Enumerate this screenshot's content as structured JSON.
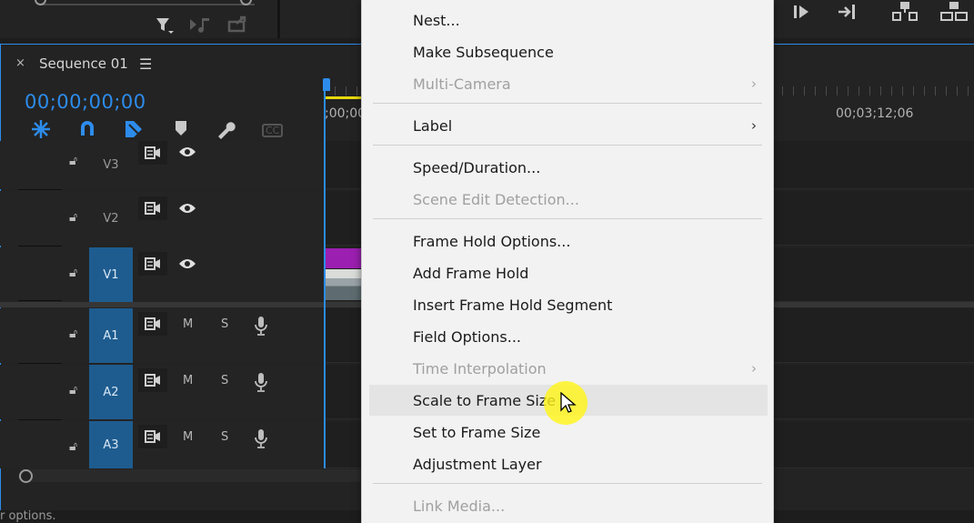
{
  "sequence": {
    "title": "Sequence 01",
    "close_glyph": "×",
    "menu_glyph": "☰",
    "timecode": "00;00;00;00"
  },
  "ruler": {
    "start_label": ";00;00",
    "right_label": "00;03;12;06"
  },
  "tracks": [
    {
      "label": "V3",
      "type": "video",
      "targeted": false
    },
    {
      "label": "V2",
      "type": "video",
      "targeted": false
    },
    {
      "label": "V1",
      "type": "video",
      "targeted": true
    },
    {
      "label": "A1",
      "type": "audio",
      "targeted": true,
      "mute": "M",
      "solo": "S"
    },
    {
      "label": "A2",
      "type": "audio",
      "targeted": true,
      "mute": "M",
      "solo": "S"
    },
    {
      "label": "A3",
      "type": "audio",
      "targeted": true,
      "mute": "M",
      "solo": "S"
    }
  ],
  "tools": {
    "captions_label": "CC"
  },
  "context_menu": {
    "items": [
      {
        "label": "Nest...",
        "disabled": false
      },
      {
        "label": "Make Subsequence",
        "disabled": false
      },
      {
        "label": "Multi-Camera",
        "disabled": true,
        "submenu": true
      },
      {
        "label": "Label",
        "disabled": false,
        "submenu": true
      },
      {
        "label": "Speed/Duration...",
        "disabled": false
      },
      {
        "label": "Scene Edit Detection...",
        "disabled": true
      },
      {
        "label": "Frame Hold Options...",
        "disabled": false
      },
      {
        "label": "Add Frame Hold",
        "disabled": false
      },
      {
        "label": "Insert Frame Hold Segment",
        "disabled": false
      },
      {
        "label": "Field Options...",
        "disabled": false
      },
      {
        "label": "Time Interpolation",
        "disabled": true,
        "submenu": true
      },
      {
        "label": "Scale to Frame Size",
        "disabled": false,
        "hovered": true
      },
      {
        "label": "Set to Frame Size",
        "disabled": false
      },
      {
        "label": "Adjustment Layer",
        "disabled": false
      },
      {
        "label": "Link Media...",
        "disabled": true
      }
    ],
    "submenu_glyph": "›"
  },
  "status": {
    "text": "r options."
  },
  "colors": {
    "accent": "#2d8ceb",
    "track_target": "#1e5c8f",
    "clip_purple": "#9b1fb0",
    "work_area": "#e8d90e",
    "cursor_highlight": "#fff514"
  }
}
